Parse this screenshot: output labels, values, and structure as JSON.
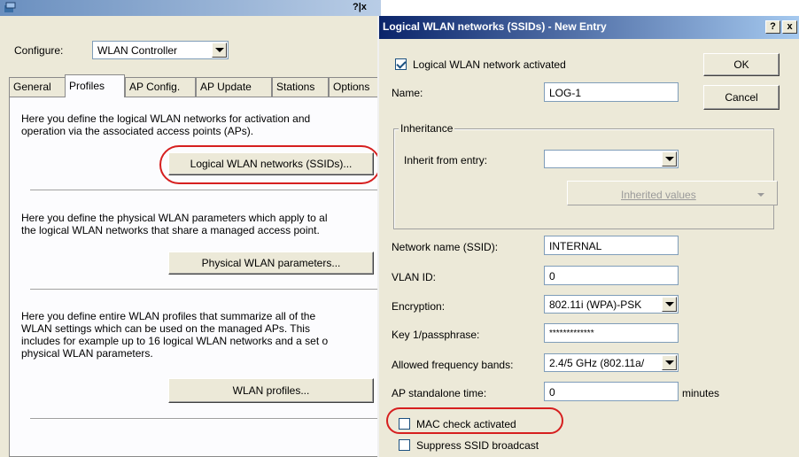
{
  "bg_window": {
    "help_buttons": "?|x",
    "configure_label": "Configure:",
    "configure_value": "WLAN Controller",
    "tabs": [
      {
        "label": "General"
      },
      {
        "label": "Profiles"
      },
      {
        "label": "AP Config."
      },
      {
        "label": "AP Update"
      },
      {
        "label": "Stations"
      },
      {
        "label": "Options"
      }
    ],
    "section1_text": [
      "Here you define the logical WLAN networks for activation and",
      "operation via the associated access points (APs)."
    ],
    "ssid_button": "Logical WLAN networks (SSIDs)...",
    "section2_text": [
      "Here you define the physical WLAN parameters which apply to al",
      "the logical WLAN networks that share a managed access point."
    ],
    "physical_button": "Physical WLAN parameters...",
    "section3_text": [
      "Here you define entire WLAN profiles that summarize all of the",
      "WLAN settings which can be used on the managed APs. This",
      "includes for example up to 16 logical WLAN networks and a set o",
      "physical WLAN parameters."
    ],
    "profiles_button": "WLAN profiles..."
  },
  "dialog": {
    "title": "Logical WLAN networks (SSIDs) - New Entry",
    "help_btn": "?",
    "close_btn": "x",
    "activated_label": "Logical WLAN network activated",
    "activated_checked": true,
    "ok_label": "OK",
    "cancel_label": "Cancel",
    "name_label": "Name:",
    "name_value": "LOG-1",
    "inheritance_title": "Inheritance",
    "inherit_label": "Inherit from entry:",
    "inherit_value": "",
    "inherited_values_label": "Inherited values",
    "ssid_label": "Network name (SSID):",
    "ssid_value": "INTERNAL",
    "vlan_label": "VLAN ID:",
    "vlan_value": "0",
    "encryption_label": "Encryption:",
    "encryption_value": "802.11i (WPA)-PSK",
    "key_label": "Key 1/passphrase:",
    "key_value": "*************",
    "freq_label": "Allowed frequency bands:",
    "freq_value": "2.4/5 GHz (802.11a/",
    "standalone_label": "AP standalone time:",
    "standalone_value": "0",
    "standalone_unit": "minutes",
    "mac_label": "MAC check activated",
    "mac_checked": false,
    "suppress_label": "Suppress SSID broadcast",
    "suppress_checked": false
  },
  "colors": {
    "dialog_titlebar": "#0a246a",
    "highlight_oval": "#d61f1f",
    "window_face": "#ece9d8"
  }
}
